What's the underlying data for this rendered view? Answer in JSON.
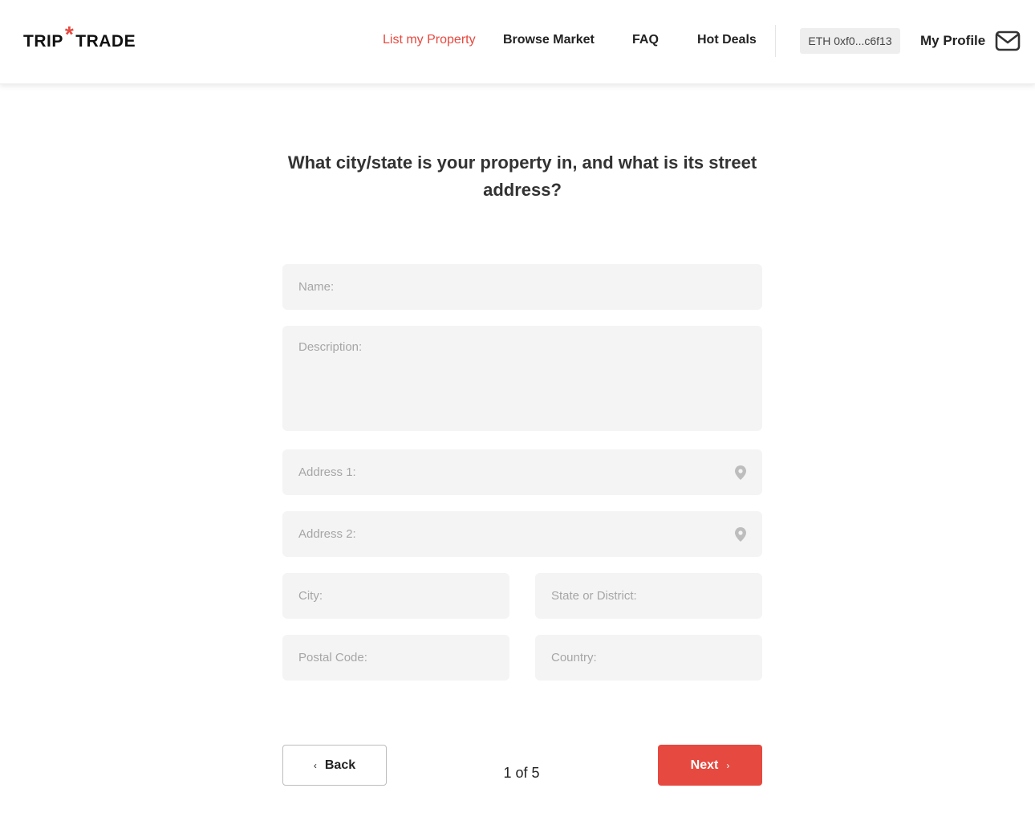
{
  "brand": {
    "left": "TRIP",
    "star": "*",
    "right": "TRADE",
    "accent_color": "#e5493f"
  },
  "nav": {
    "list_property": "List my Property",
    "browse_market": "Browse Market",
    "faq": "FAQ",
    "hot_deals": "Hot Deals",
    "wallet": "ETH 0xf0...c6f13",
    "profile": "My Profile"
  },
  "form": {
    "question": "What city/state is your property in, and what is its street address?",
    "name_placeholder": "Name:",
    "description_placeholder": "Description:",
    "address1_placeholder": "Address 1:",
    "address2_placeholder": "Address 2:",
    "city_placeholder": "City:",
    "state_placeholder": "State or District:",
    "postal_placeholder": "Postal Code:",
    "country_placeholder": "Country:"
  },
  "footer": {
    "back_chevron": "‹",
    "back_label": "Back",
    "next_label": "Next",
    "next_chevron": "›",
    "pager": "1 of 5"
  },
  "icons": [
    "mail-icon",
    "location-pin-icon"
  ]
}
